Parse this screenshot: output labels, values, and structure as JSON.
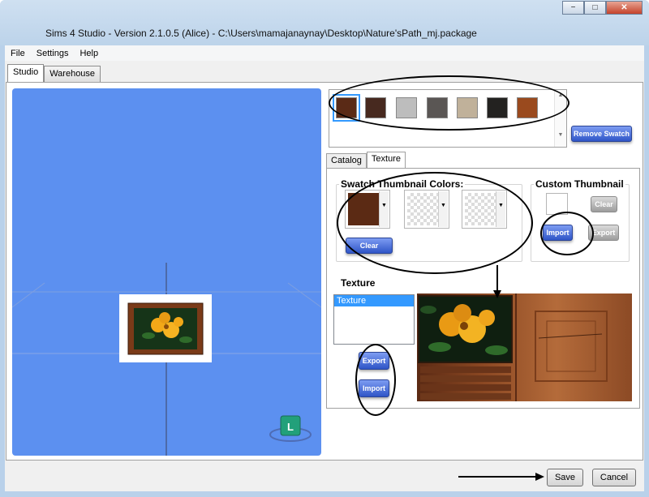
{
  "window": {
    "title": "Sims 4 Studio - Version 2.1.0.5  (Alice)   - C:\\Users\\mamajanaynay\\Desktop\\Nature'sPath_mj.package",
    "caption_minimize": "−",
    "caption_maximize": "□",
    "caption_close": "✕"
  },
  "menu": [
    "File",
    "Settings",
    "Help"
  ],
  "main_tabs": [
    "Studio",
    "Warehouse"
  ],
  "swatches": {
    "colors": [
      "#5a2a16",
      "#47291f",
      "#bdbdbd",
      "#5a5654",
      "#c0b19a",
      "#232220",
      "#9a4a1e"
    ],
    "selected_index": 0,
    "remove_label": "Remove Swatch"
  },
  "inner_tabs": [
    "Catalog",
    "Texture"
  ],
  "thumbnail_colors": {
    "title": "Swatch Thumbnail Colors:",
    "color1": "#5b2a14",
    "clear_label": "Clear"
  },
  "custom_thumbnail": {
    "title": "Custom Thumbnail",
    "clear_label": "Clear",
    "import_label": "Import",
    "export_label": "Export"
  },
  "texture": {
    "title": "Texture",
    "list_items": [
      "Texture"
    ],
    "export_label": "Export",
    "import_label": "Import"
  },
  "viewport": {
    "background": "#5c90f0",
    "badge_letter": "L"
  },
  "footer": {
    "save_label": "Save",
    "cancel_label": "Cancel"
  }
}
